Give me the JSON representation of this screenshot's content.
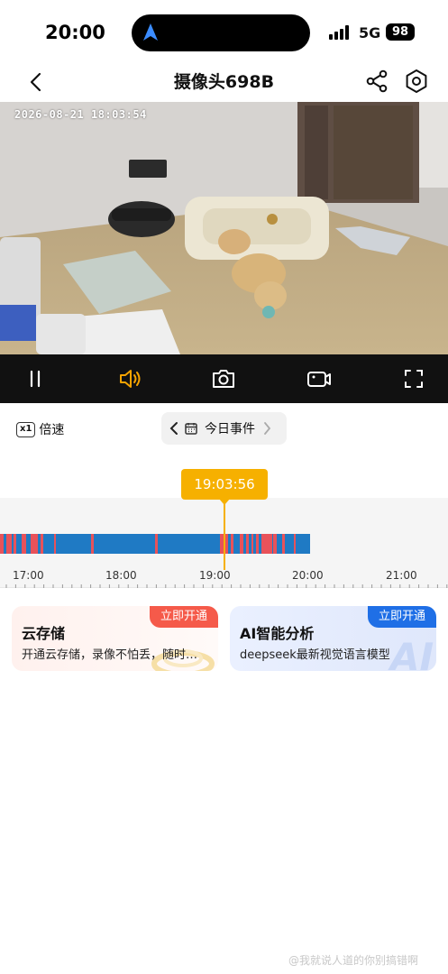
{
  "status": {
    "time": "20:00",
    "network": "5G",
    "battery": "98"
  },
  "header": {
    "title": "摄像头698B",
    "back_icon": "chevron-left-icon",
    "share_icon": "share-icon",
    "settings_icon": "hexagon-gear-icon"
  },
  "video": {
    "timestamp": "2026-08-21  18:03:54"
  },
  "controls": {
    "items": [
      "pause-icon",
      "speaker-icon",
      "camera-snapshot-icon",
      "video-record-icon",
      "fullscreen-icon"
    ],
    "active_color": "#f6a300"
  },
  "toolbar": {
    "speed_badge": "x1",
    "speed_label": "倍速",
    "events_label": "今日事件"
  },
  "timeline": {
    "cursor_time": "19:03:56",
    "hours": [
      "17:00",
      "18:00",
      "19:00",
      "20:00",
      "21:00"
    ],
    "colors": {
      "recording": "#1f7ac4",
      "event": "#e8525a",
      "cursor": "#f6b000"
    }
  },
  "cards": {
    "cloud": {
      "title": "云存储",
      "subtitle": "开通云存储，录像不怕丢，随时…",
      "badge": "立即开通"
    },
    "ai": {
      "title": "AI智能分析",
      "subtitle": "deepseek最新视觉语言模型",
      "badge": "立即开通",
      "deco": "AI"
    }
  },
  "watermark": "@我就说人道的你别搞错啊"
}
